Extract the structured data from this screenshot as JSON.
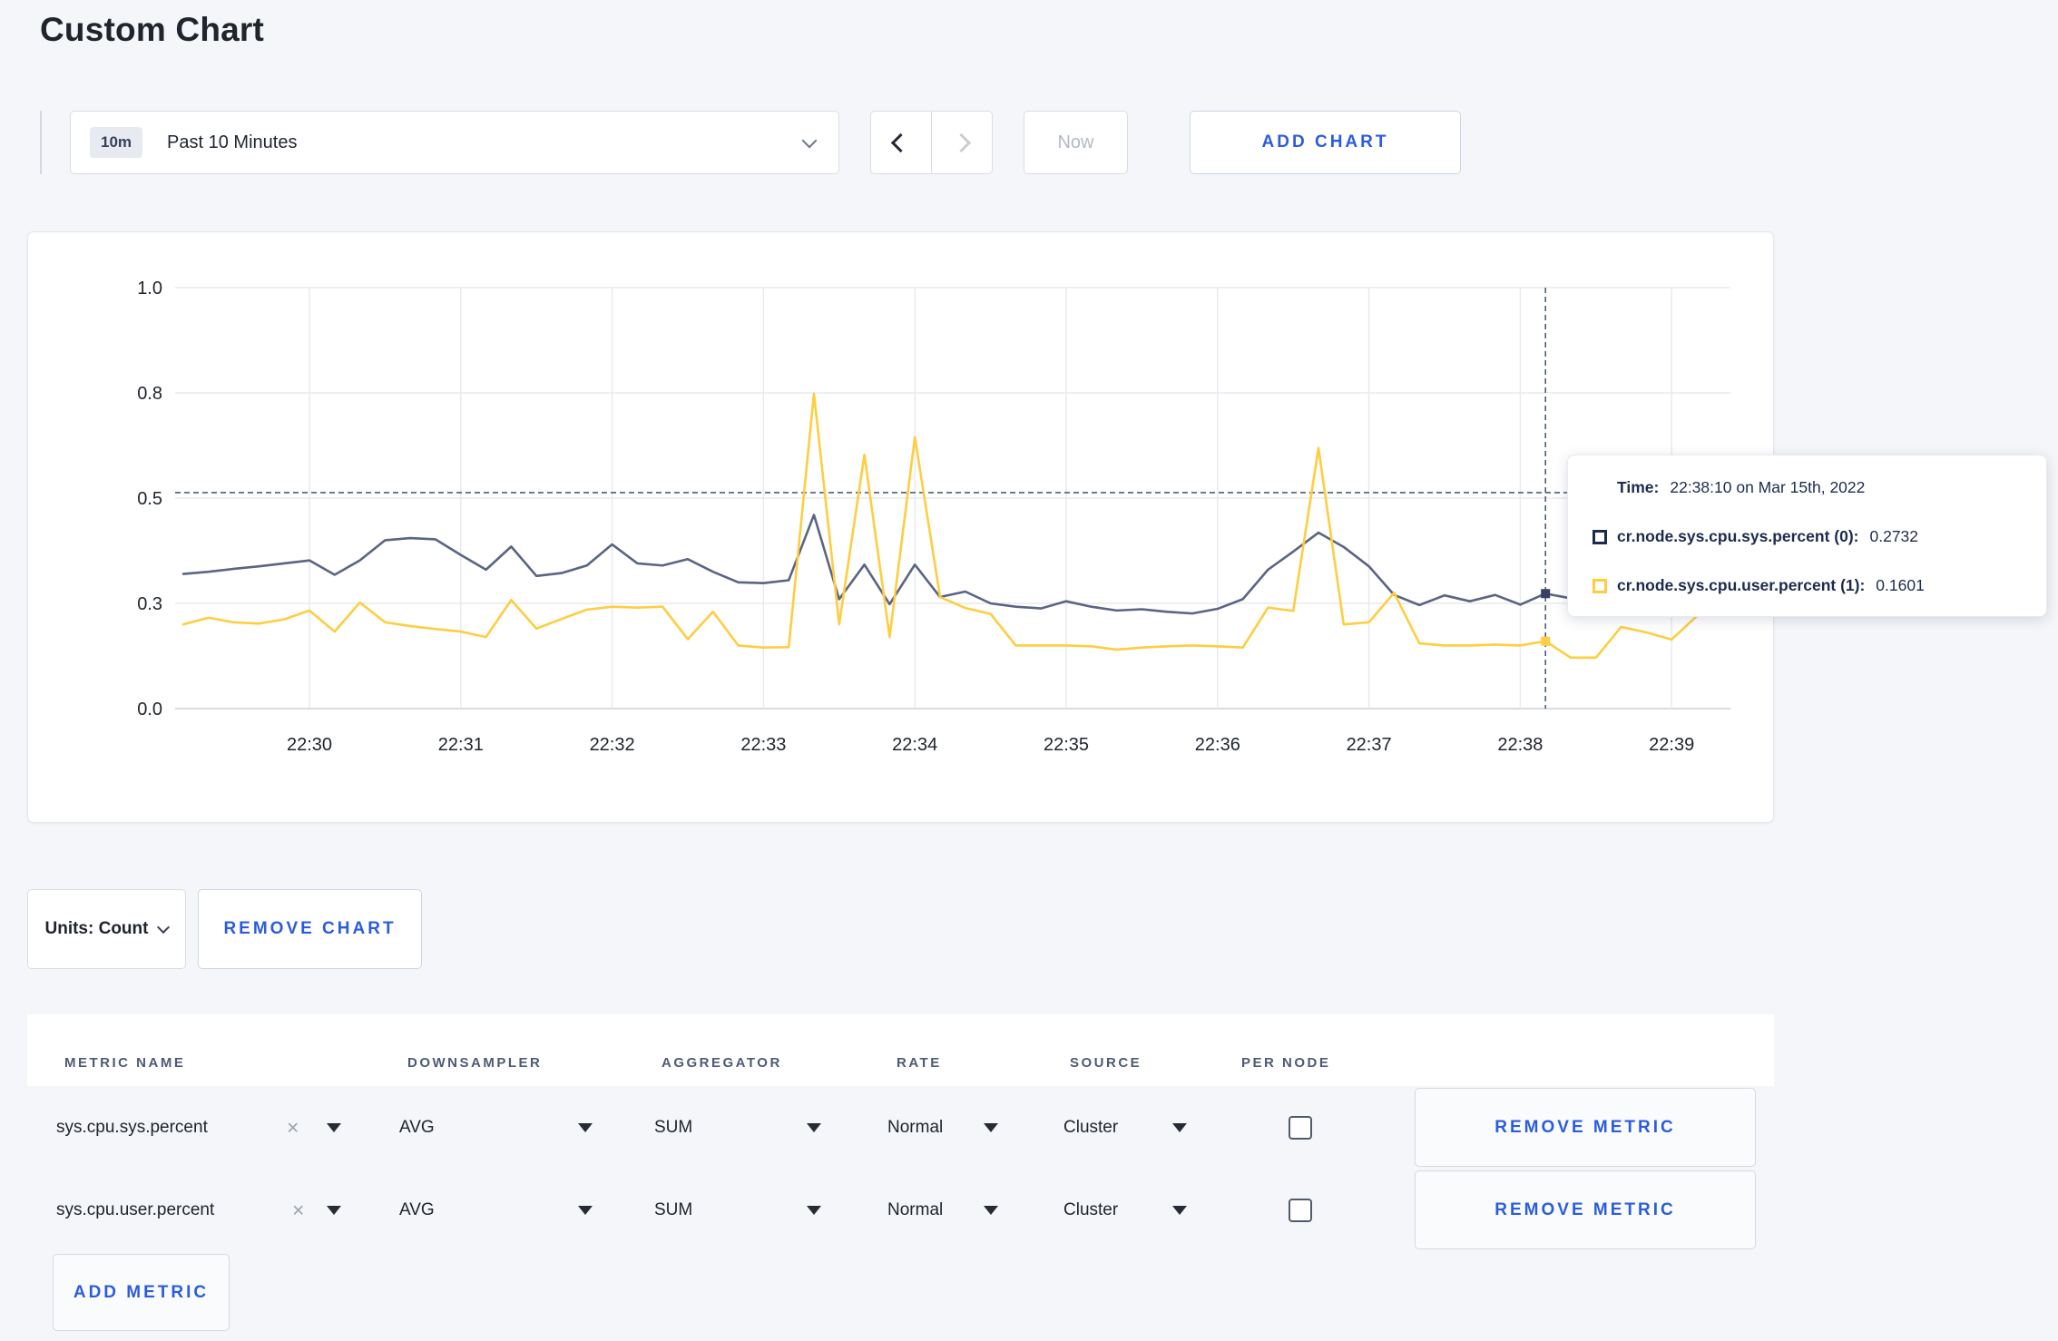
{
  "title": "Custom Chart",
  "colors": {
    "page_bg": "#f4f6f9",
    "accent_blue": "#2b5ce0",
    "series_sys": "#5a6483",
    "series_user": "#ffcd40",
    "crosshair": "#4d5d7c",
    "grid": "#e9eaee"
  },
  "toolbar": {
    "range_badge": "10m",
    "range_label": "Past 10 Minutes",
    "now_label": "Now",
    "add_chart_label": "ADD CHART"
  },
  "chart_data": {
    "type": "line",
    "title": "",
    "x_start": "22:29:10",
    "x_step_seconds": 10,
    "x_axis_labels": [
      "22:30",
      "22:31",
      "22:32",
      "22:33",
      "22:34",
      "22:35",
      "22:36",
      "22:37",
      "22:38",
      "22:39"
    ],
    "ylim": [
      0,
      1
    ],
    "grid": true,
    "y_ticks": [
      {
        "v": 1.0,
        "label": "1.0"
      },
      {
        "v": 0.75,
        "label": "0.8"
      },
      {
        "v": 0.5,
        "label": "0.5"
      },
      {
        "v": 0.25,
        "label": "0.3"
      },
      {
        "v": 0.0,
        "label": "0.0"
      }
    ],
    "series": [
      {
        "name": "cr.node.sys.cpu.sys.percent",
        "color": "#5a6483",
        "marker_color": "#37415f",
        "values": [
          0.32,
          0.325,
          0.332,
          0.338,
          0.345,
          0.352,
          0.318,
          0.352,
          0.4,
          0.405,
          0.402,
          0.365,
          0.33,
          0.385,
          0.315,
          0.322,
          0.34,
          0.39,
          0.345,
          0.34,
          0.355,
          0.325,
          0.3,
          0.298,
          0.305,
          0.46,
          0.26,
          0.342,
          0.248,
          0.342,
          0.265,
          0.278,
          0.25,
          0.242,
          0.238,
          0.255,
          0.242,
          0.233,
          0.236,
          0.23,
          0.226,
          0.237,
          0.26,
          0.33,
          0.373,
          0.418,
          0.384,
          0.338,
          0.27,
          0.246,
          0.269,
          0.255,
          0.27,
          0.247,
          0.2732,
          0.262,
          0.255,
          0.26,
          0.268,
          0.272,
          0.285
        ]
      },
      {
        "name": "cr.node.sys.cpu.user.percent",
        "color": "#ffcd40",
        "marker_color": "#ffcd40",
        "values": [
          0.2,
          0.216,
          0.205,
          0.202,
          0.212,
          0.233,
          0.183,
          0.252,
          0.205,
          0.196,
          0.189,
          0.183,
          0.17,
          0.258,
          0.19,
          0.213,
          0.235,
          0.242,
          0.24,
          0.242,
          0.165,
          0.23,
          0.15,
          0.145,
          0.146,
          0.748,
          0.2,
          0.603,
          0.17,
          0.645,
          0.265,
          0.239,
          0.225,
          0.15,
          0.15,
          0.15,
          0.148,
          0.14,
          0.145,
          0.148,
          0.15,
          0.148,
          0.145,
          0.24,
          0.232,
          0.619,
          0.2,
          0.205,
          0.275,
          0.155,
          0.15,
          0.15,
          0.152,
          0.15,
          0.1601,
          0.121,
          0.121,
          0.194,
          0.181,
          0.164,
          0.22
        ]
      }
    ],
    "crosshair": {
      "index": 54,
      "time": "22:38:10",
      "h_value": 0.513
    }
  },
  "tooltip": {
    "time_label": "Time:",
    "time_value": "22:38:10 on Mar 15th, 2022",
    "rows": [
      {
        "name": "cr.node.sys.cpu.sys.percent (0):",
        "value": "0.2732",
        "color": "#1b2b4d"
      },
      {
        "name": "cr.node.sys.cpu.user.percent (1):",
        "value": "0.1601",
        "color": "#ffcd40"
      }
    ]
  },
  "units_row": {
    "units_label": "Units: Count",
    "remove_chart_label": "REMOVE CHART"
  },
  "metrics_table": {
    "headers": [
      "METRIC NAME",
      "DOWNSAMPLER",
      "AGGREGATOR",
      "RATE",
      "SOURCE",
      "PER NODE"
    ],
    "remove_icon": "×",
    "rows": [
      {
        "metric": "sys.cpu.sys.percent",
        "downsampler": "AVG",
        "aggregator": "SUM",
        "rate": "Normal",
        "source": "Cluster",
        "per_node": false,
        "remove_label": "REMOVE METRIC"
      },
      {
        "metric": "sys.cpu.user.percent",
        "downsampler": "AVG",
        "aggregator": "SUM",
        "rate": "Normal",
        "source": "Cluster",
        "per_node": false,
        "remove_label": "REMOVE METRIC"
      }
    ],
    "add_metric_label": "ADD METRIC"
  }
}
